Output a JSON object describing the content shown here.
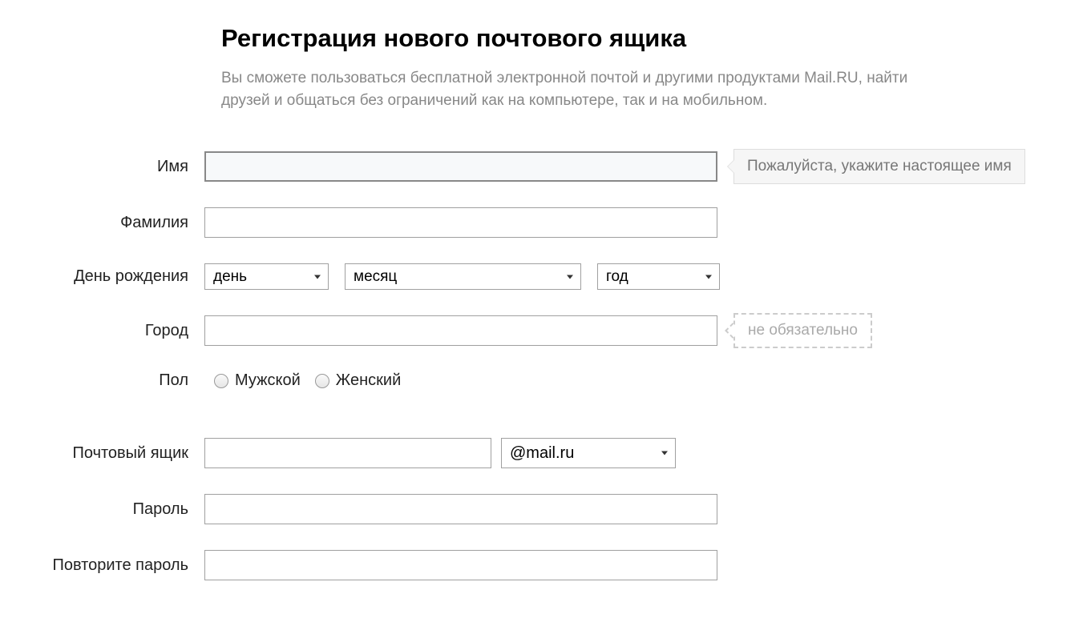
{
  "header": {
    "title": "Регистрация нового почтового ящика",
    "subtitle": "Вы сможете пользоваться бесплатной электронной почтой и другими продуктами Mail.RU, найти друзей и общаться без ограничений как на компьютере, так и на мобильном."
  },
  "fields": {
    "firstName": {
      "label": "Имя",
      "tooltip": "Пожалуйста, укажите настоящее имя"
    },
    "lastName": {
      "label": "Фамилия"
    },
    "birthday": {
      "label": "День рождения",
      "day": "день",
      "month": "месяц",
      "year": "год"
    },
    "city": {
      "label": "Город",
      "hint": "не обязательно"
    },
    "gender": {
      "label": "Пол",
      "male": "Мужской",
      "female": "Женский"
    },
    "mailbox": {
      "label": "Почтовый ящик",
      "domain": "@mail.ru"
    },
    "password": {
      "label": "Пароль"
    },
    "passwordRepeat": {
      "label": "Повторите пароль"
    }
  }
}
